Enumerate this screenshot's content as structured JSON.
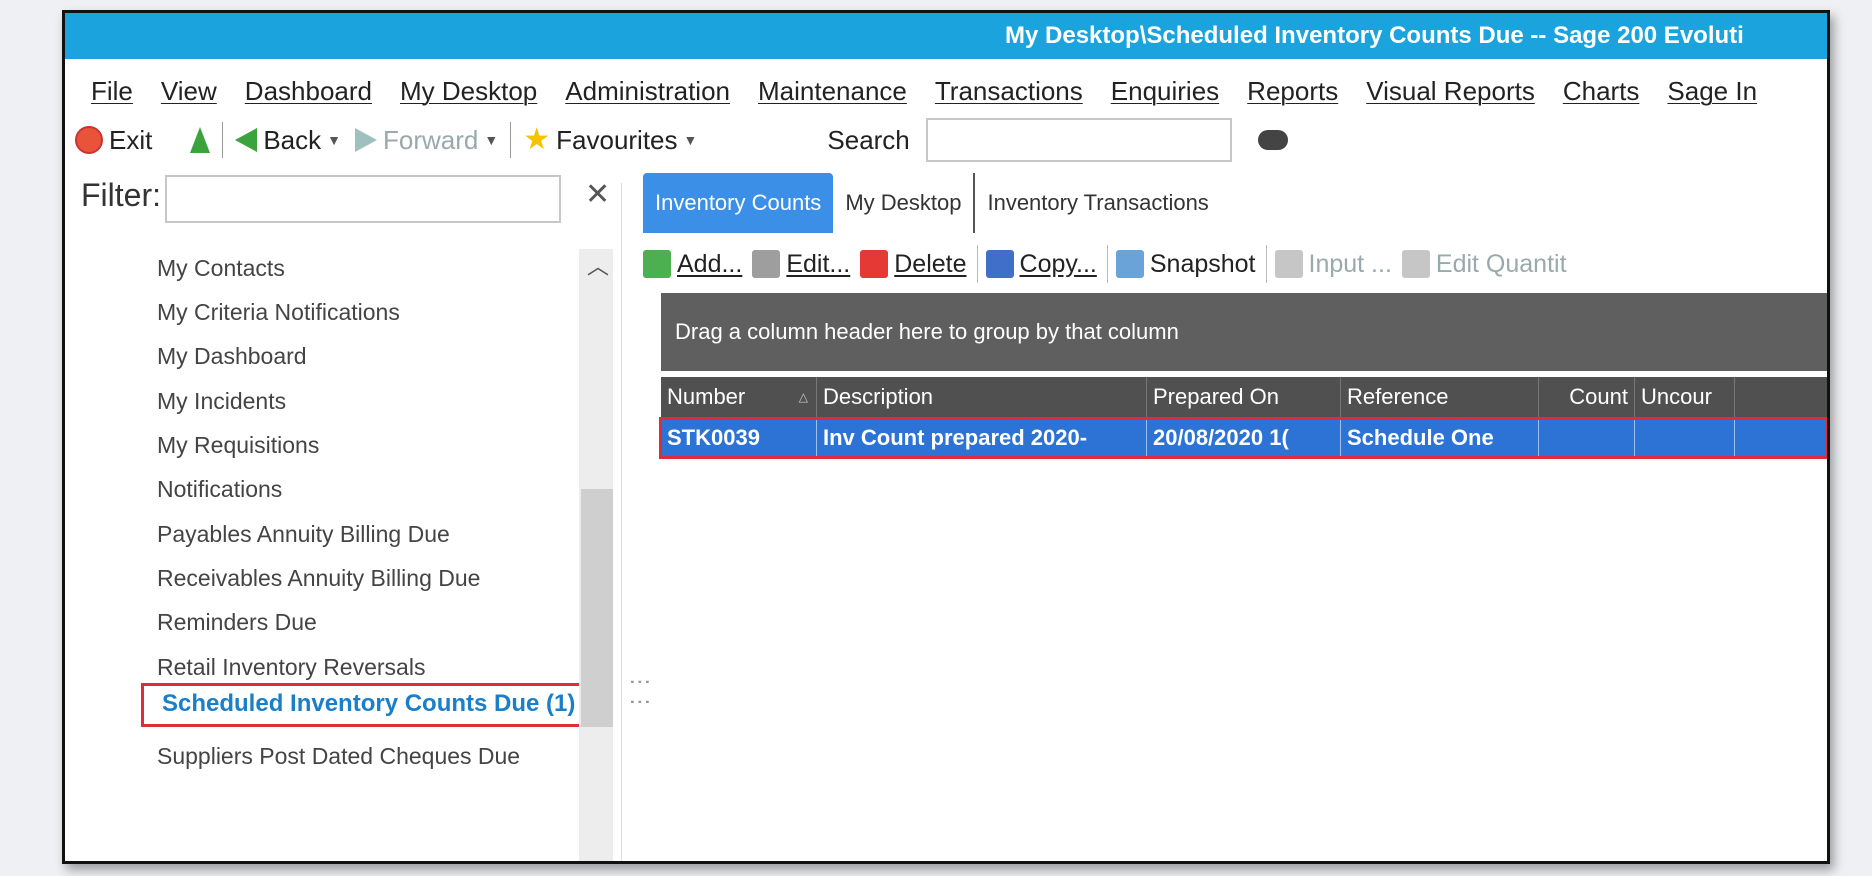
{
  "window": {
    "title": "My Desktop\\Scheduled Inventory Counts Due -- Sage 200 Evoluti"
  },
  "menu": [
    "File",
    "View",
    "Dashboard",
    "My Desktop",
    "Administration",
    "Maintenance",
    "Transactions",
    "Enquiries",
    "Reports",
    "Visual Reports",
    "Charts",
    "Sage In"
  ],
  "toolbar": {
    "exit": "Exit",
    "back": "Back",
    "forward": "Forward",
    "favourites": "Favourites",
    "search_label": "Search",
    "search_value": ""
  },
  "left": {
    "filter_label": "Filter:",
    "filter_value": "",
    "items": [
      "My Contacts",
      "My Criteria Notifications",
      "My Dashboard",
      "My Incidents",
      "My Requisitions",
      "Notifications",
      "Payables Annuity Billing Due",
      "Receivables Annuity Billing Due",
      "Reminders Due",
      "Retail Inventory Reversals",
      "Scheduled Inventory Counts Due (1)",
      "Suppliers Post Dated Cheques Due"
    ]
  },
  "tabs": [
    "Inventory Counts",
    "My Desktop",
    "Inventory Transactions"
  ],
  "actions": {
    "add": "Add...",
    "edit": "Edit...",
    "delete": "Delete",
    "copy": "Copy...",
    "snapshot": "Snapshot",
    "input": "Input ...",
    "edit_quantity": "Edit Quantit"
  },
  "grid": {
    "group_hint": "Drag a column header here to group by that column",
    "columns": [
      "Number",
      "Description",
      "Prepared On",
      "Reference",
      "Count",
      "Uncour"
    ],
    "rows": [
      [
        "STK0039",
        "Inv Count prepared 2020-",
        "20/08/2020 1(",
        "Schedule One",
        "",
        ""
      ]
    ]
  },
  "colors": {
    "title_bar": "#1aa3dc",
    "selection": "#2d73d6",
    "highlight_box": "#e02c3a",
    "active_tab": "#3b8fe6"
  }
}
